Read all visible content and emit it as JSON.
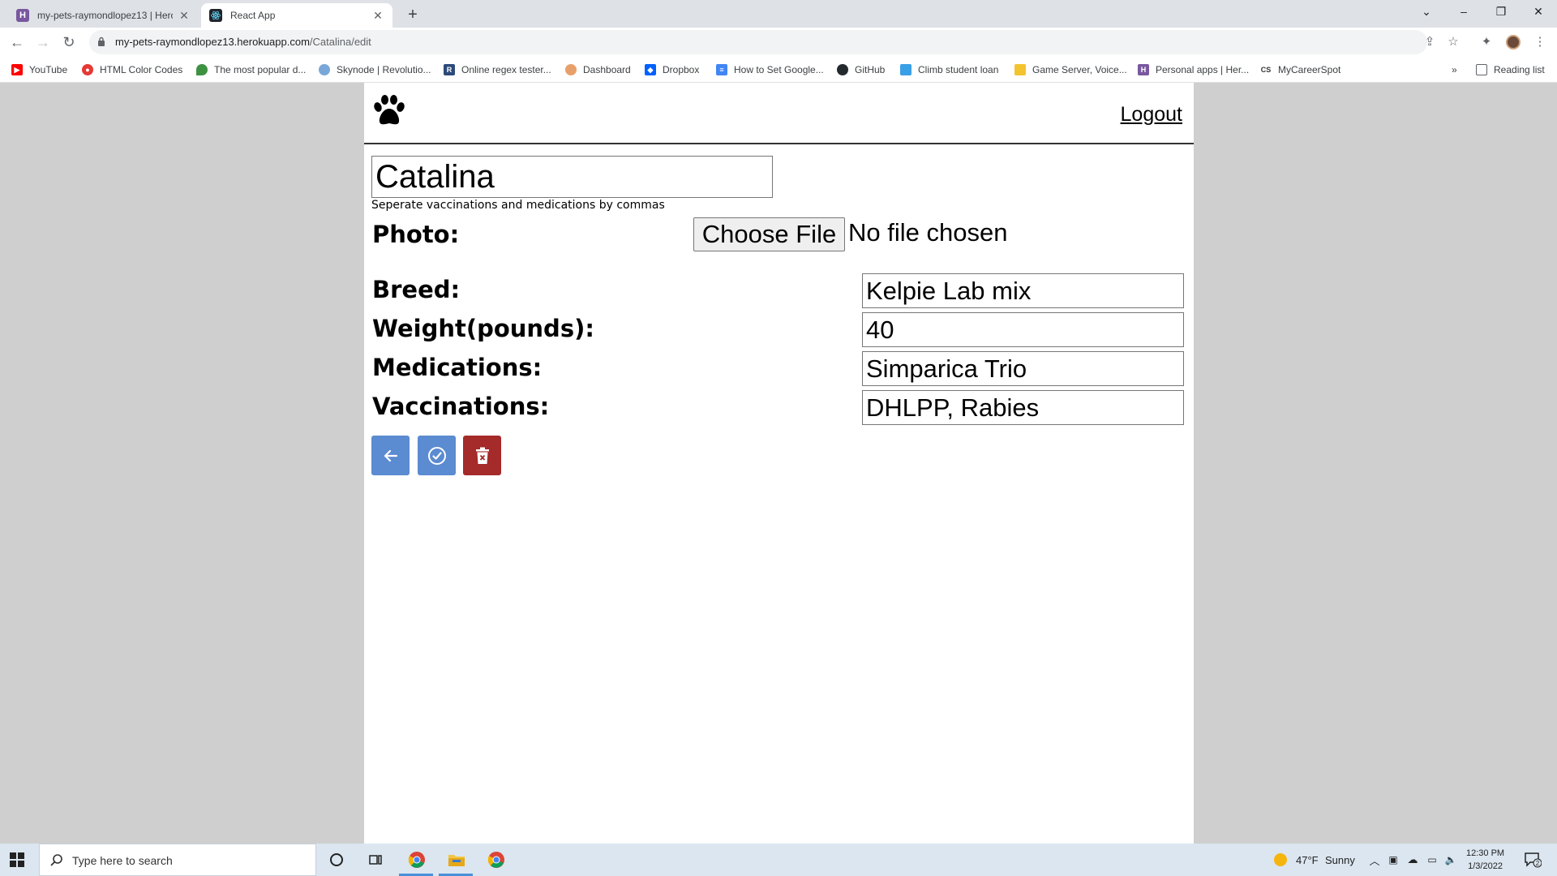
{
  "browser": {
    "tabs": [
      {
        "title": "my-pets-raymondlopez13 | Hero",
        "favicon": "heroku-icon",
        "active": false
      },
      {
        "title": "React App",
        "favicon": "react-icon",
        "active": true
      }
    ],
    "url_host": "my-pets-raymondlopez13.herokuapp.com",
    "url_path": "/Catalina/edit",
    "bookmarks": [
      {
        "label": "YouTube",
        "icon": "youtube-icon",
        "color": "#ff0000"
      },
      {
        "label": "HTML Color Codes",
        "icon": "color-codes-icon",
        "color": "#e53935"
      },
      {
        "label": "The most popular d...",
        "icon": "leaf-icon",
        "color": "#3f9142"
      },
      {
        "label": "Skynode | Revolutio...",
        "icon": "cloud-icon",
        "color": "#7aa7d9"
      },
      {
        "label": "Online regex tester...",
        "icon": "regex-icon",
        "color": "#2c4a7a"
      },
      {
        "label": "Dashboard",
        "icon": "dashboard-icon",
        "color": "#e8a06a"
      },
      {
        "label": "Dropbox",
        "icon": "dropbox-icon",
        "color": "#0061ff"
      },
      {
        "label": "How to Set Google...",
        "icon": "docs-icon",
        "color": "#4285f4"
      },
      {
        "label": "GitHub",
        "icon": "github-icon",
        "color": "#24292e"
      },
      {
        "label": "Climb student loan",
        "icon": "climb-icon",
        "color": "#3aa0e6"
      },
      {
        "label": "Game Server, Voice...",
        "icon": "game-server-icon",
        "color": "#f4c430"
      },
      {
        "label": "Personal apps | Her...",
        "icon": "heroku-icon",
        "color": "#79589f"
      },
      {
        "label": "MyCareerSpot",
        "icon": "cs-icon",
        "color": "#333333"
      }
    ],
    "reading_list": "Reading list",
    "more": "»"
  },
  "app": {
    "logout": "Logout",
    "pet_name": "Catalina",
    "hint": "Seperate vaccinations and medications by commas",
    "photo_label": "Photo:",
    "choose_file": "Choose File",
    "no_file": "No file chosen",
    "fields": [
      {
        "label": "Breed:",
        "value": "Kelpie Lab mix"
      },
      {
        "label": "Weight(pounds):",
        "value": "40"
      },
      {
        "label": "Medications:",
        "value": "Simparica Trio"
      },
      {
        "label": "Vaccinations:",
        "value": "DHLPP, Rabies"
      }
    ],
    "colors": {
      "primary": "#5b8bd0",
      "danger": "#a52a2a"
    }
  },
  "taskbar": {
    "search_placeholder": "Type here to search",
    "weather_temp": "47°F",
    "weather_text": "Sunny",
    "time": "12:30 PM",
    "date": "1/3/2022",
    "notifications": "2"
  }
}
